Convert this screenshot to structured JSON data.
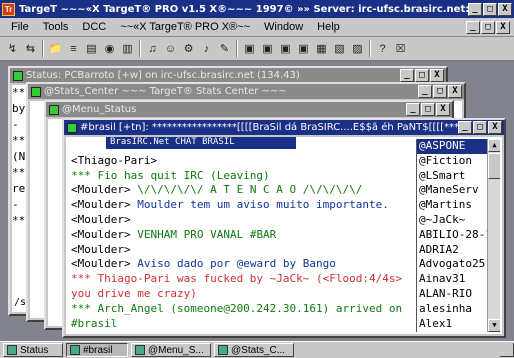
{
  "app": {
    "title": "TargeT ~~~«X TargeT® PRO v1.5 X®~~~ 1997© »» Server: irc-ufsc.brasirc.net:6667 ««",
    "icon_text": "Tr"
  },
  "window_buttons": {
    "minimize": "_",
    "maximize": "□",
    "close": "X"
  },
  "menu": {
    "items": [
      "File",
      "Tools",
      "DCC",
      "~~«X TargeT® PRO X®~~",
      "Window",
      "Help"
    ]
  },
  "toolbar": {
    "icons": [
      "connect-icon",
      "disconnect-icon",
      "folder-icon",
      "options-icon",
      "list-icon",
      "globe-icon",
      "channels-icon",
      "notify-icon",
      "user-icon",
      "settings-icon",
      "sound-icon",
      "tools-icon",
      "window-icon",
      "window-icon",
      "window-icon",
      "window-icon",
      "tile-icon",
      "cascade-icon",
      "arrange-icon",
      "help-icon",
      "exit-icon"
    ],
    "glyphs": [
      "↯",
      "⇆",
      "📁",
      "≡",
      "▤",
      "◉",
      "▥",
      "♫",
      "☺",
      "⚙",
      "♪",
      "✎",
      "▣",
      "▣",
      "▣",
      "▣",
      "▦",
      "▧",
      "▨",
      "?",
      "☒"
    ]
  },
  "windows": {
    "status": {
      "title": "Status: PCBarroto [+w] on irc-ufsc.brasirc.net (134.43)"
    },
    "stats_center": {
      "title": "@Stats_Center ~~~ TargeT® Stats Center ~~~"
    },
    "menu_status": {
      "title": "@Menu_Status"
    },
    "channel": {
      "title": "#brasil [+tn]: *****************[[[[BraSil dá BraSIRC....É$$ã éh PaÑT$[[[[*****************"
    }
  },
  "status_left": [
    "**",
    "by",
    "-",
    "**",
    "(N",
    "**",
    "re",
    "-",
    "**"
  ],
  "status_footer": "/sta",
  "chat": {
    "topic_overlay": "BrasIRC.Net CHAT BRASIL",
    "lines": [
      {
        "nick": "",
        "text": "",
        "cls": "nick"
      },
      {
        "nick": "<Thiago-Pari>",
        "text": "",
        "cls": "nick"
      },
      {
        "nick": "",
        "text": "*** Fio has quit IRC (Leaving)",
        "cls": "grn"
      },
      {
        "nick": "<Moulder>",
        "text": " \\/\\/\\/\\/\\/ A T E N C A O /\\/\\/\\/\\/",
        "cls": "grn"
      },
      {
        "nick": "<Moulder>",
        "text": "   Moulder tem um aviso muito importante.",
        "cls": "blu"
      },
      {
        "nick": "<Moulder>",
        "text": "",
        "cls": "nick"
      },
      {
        "nick": "<Moulder>",
        "text": "   VENHAM PRO VANAL #BAR",
        "cls": "grn"
      },
      {
        "nick": "<Moulder>",
        "text": "",
        "cls": "nick"
      },
      {
        "nick": "<Moulder>",
        "text": "   Aviso dado por @eward  by Bango",
        "cls": "blu"
      },
      {
        "nick": "",
        "text": "*** Thiago-Pari was fucked by ~JaCk~ (<Flood:4/4s>",
        "cls": "sys"
      },
      {
        "nick": "",
        "text": "you drive me crazy)",
        "cls": "sys"
      },
      {
        "nick": "",
        "text": "*** Arch_Angel (someone@200.242.30.161) arrived on",
        "cls": "grn"
      },
      {
        "nick": "",
        "text": "#brasil",
        "cls": "grn"
      }
    ]
  },
  "nicklist": [
    "@ASPONE",
    "@Fiction",
    "@LSmart",
    "@ManeServ",
    "@Martins",
    "@~JaCk~",
    "ABILIO-28-1",
    "ADRIA2",
    "Advogato25",
    "Ainav31",
    "ALAN-RIO",
    "alesinha",
    "Alex1"
  ],
  "taskbar": {
    "items": [
      {
        "label": "Status",
        "active": false
      },
      {
        "label": "#brasil",
        "active": true
      },
      {
        "label": "@Menu_S...",
        "active": false
      },
      {
        "label": "@Stats_C...",
        "active": false
      }
    ]
  },
  "colors": {
    "active_title": "#1a2f86",
    "inactive_title": "#8a8a8a",
    "mdi_background": "#838390",
    "join_green": "#107a10",
    "kick_red": "#d03030"
  }
}
